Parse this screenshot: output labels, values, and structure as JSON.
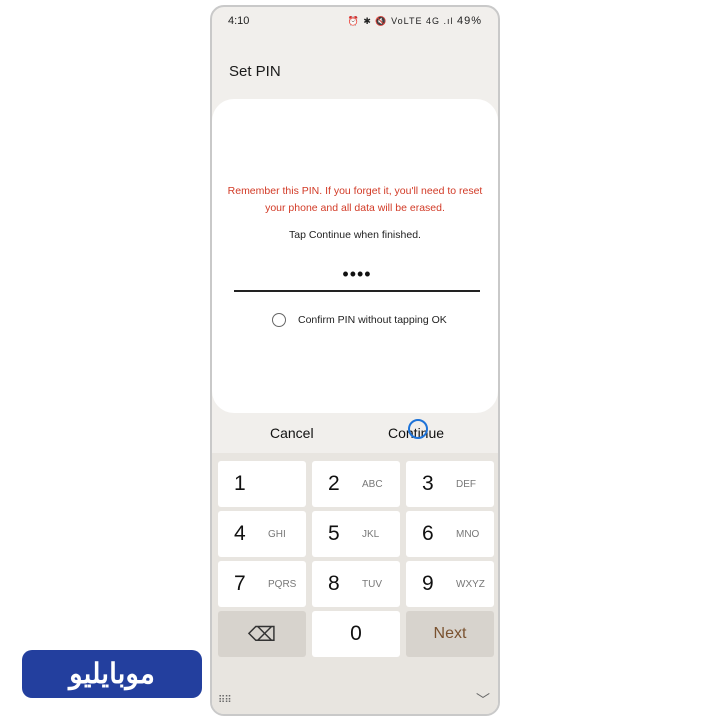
{
  "status": {
    "time": "4:10",
    "icons": "⏰ ✱ 🔇 VoLTE 4G .ıl",
    "battery": "49%"
  },
  "header": {
    "title": "Set PIN"
  },
  "card": {
    "warning": "Remember this PIN. If you forget it, you'll need to reset your phone and all data will be erased.",
    "hint": "Tap Continue when finished.",
    "pin_value": "••••",
    "confirm_label": "Confirm PIN without tapping OK"
  },
  "actions": {
    "cancel": "Cancel",
    "continue": "Continue"
  },
  "keypad": {
    "k1": {
      "num": "1",
      "letters": ""
    },
    "k2": {
      "num": "2",
      "letters": "ABC"
    },
    "k3": {
      "num": "3",
      "letters": "DEF"
    },
    "k4": {
      "num": "4",
      "letters": "GHI"
    },
    "k5": {
      "num": "5",
      "letters": "JKL"
    },
    "k6": {
      "num": "6",
      "letters": "MNO"
    },
    "k7": {
      "num": "7",
      "letters": "PQRS"
    },
    "k8": {
      "num": "8",
      "letters": "TUV"
    },
    "k9": {
      "num": "9",
      "letters": "WXYZ"
    },
    "k0": {
      "num": "0"
    },
    "next": "Next",
    "backspace_icon": "⌫",
    "keyboard_icon": "⠿⠿",
    "chevron_icon": "﹀"
  },
  "watermark": {
    "text": "موبایلیو"
  },
  "colors": {
    "warning": "#d23a26",
    "accent_ring": "#1e73d8",
    "next_text": "#7a5230",
    "logo": "#233f9e"
  }
}
